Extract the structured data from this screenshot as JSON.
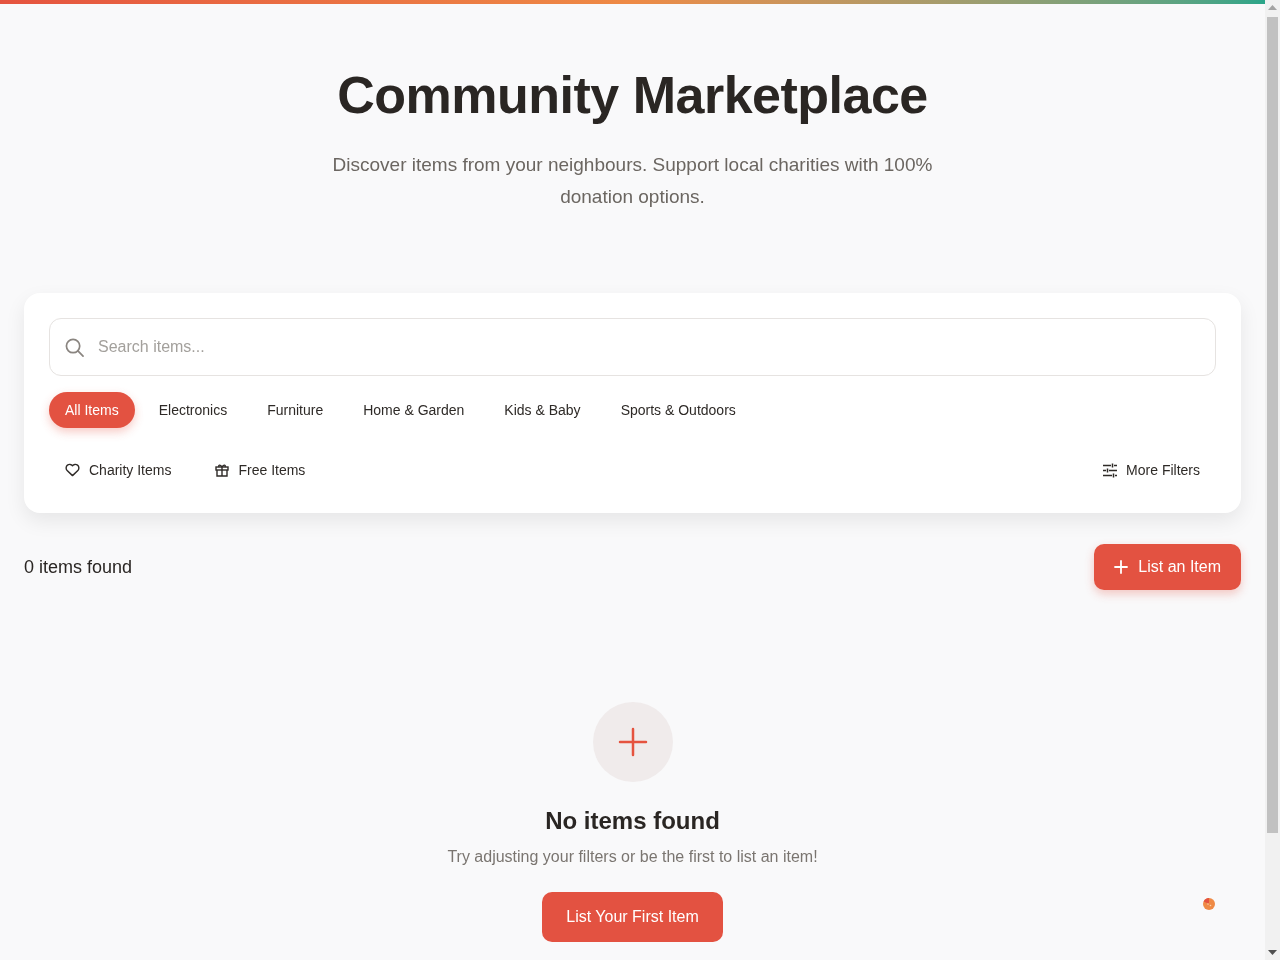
{
  "header": {
    "title": "Community Marketplace",
    "subtitle": "Discover items from your neighbours. Support local charities with 100% donation options."
  },
  "search": {
    "placeholder": "Search items..."
  },
  "categories": [
    {
      "label": "All Items",
      "selected": true
    },
    {
      "label": "Electronics",
      "selected": false
    },
    {
      "label": "Furniture",
      "selected": false
    },
    {
      "label": "Home & Garden",
      "selected": false
    },
    {
      "label": "Kids & Baby",
      "selected": false
    },
    {
      "label": "Sports & Outdoors",
      "selected": false
    }
  ],
  "filters": [
    {
      "label": "Charity Items",
      "kind": "heart"
    },
    {
      "label": "Free Items",
      "kind": "gift"
    }
  ],
  "more_filters": {
    "label": "More Filters"
  },
  "results": {
    "count": "0 items found",
    "action": "List an Item"
  },
  "empty_state": {
    "title": "No items found",
    "message": "Try adjusting your filters or be the first to list an item!",
    "action": "List Your First Item"
  }
}
